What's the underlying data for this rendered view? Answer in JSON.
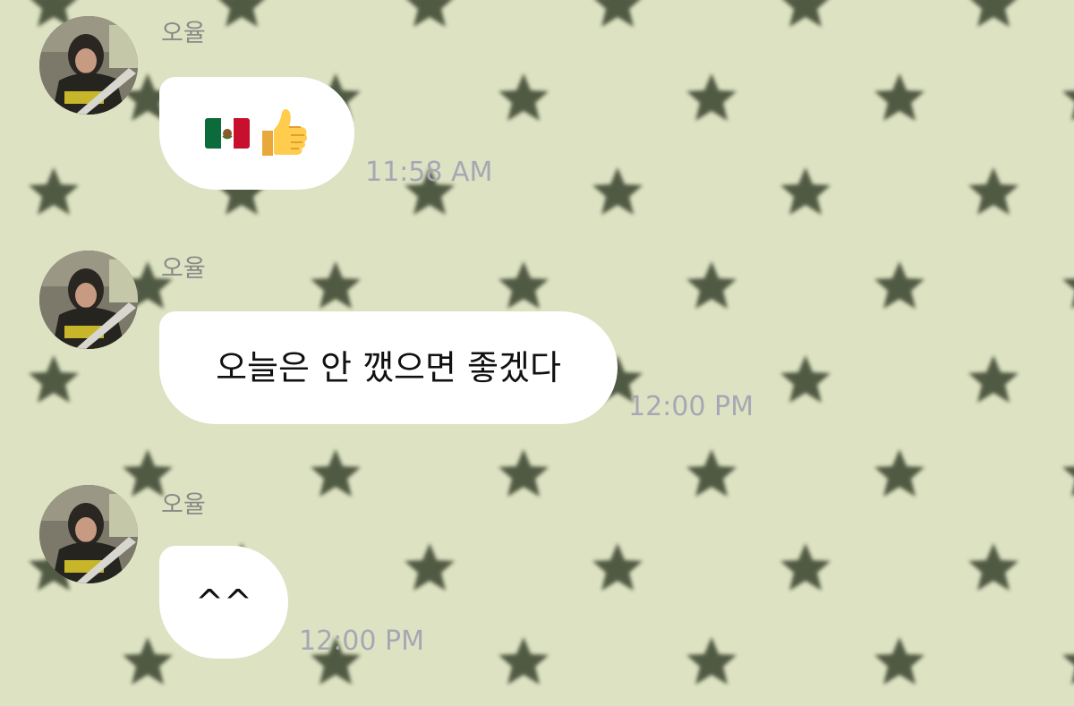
{
  "colors": {
    "background": "#dde2c2",
    "star": "#3c4632",
    "bubble": "#ffffff",
    "sender_name": "#8a8a86",
    "timestamp": "#a5a8b4"
  },
  "messages": [
    {
      "sender": "오율",
      "content_icons": [
        "mexico-flag-icon",
        "thumbs-up-icon"
      ],
      "time": "11:58 AM"
    },
    {
      "sender": "오율",
      "text": "오늘은 안 깼으면 좋겠다",
      "time": "12:00 PM"
    },
    {
      "sender": "오율",
      "text": "^^",
      "time": "12:00 PM"
    }
  ]
}
